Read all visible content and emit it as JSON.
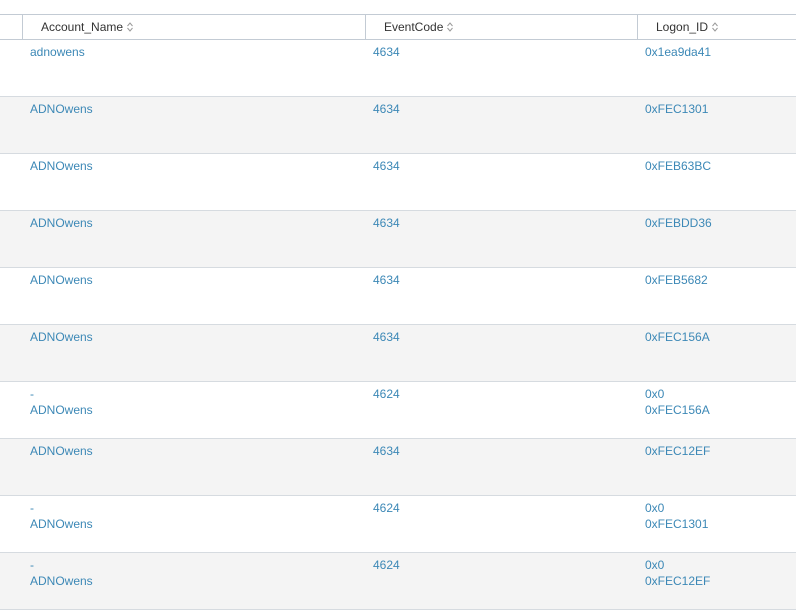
{
  "columns": [
    {
      "label": "Account_Name"
    },
    {
      "label": "EventCode"
    },
    {
      "label": "Logon_ID"
    }
  ],
  "rows": [
    {
      "account": [
        "adnowens"
      ],
      "event": "4634",
      "logon": [
        "0x1ea9da41"
      ]
    },
    {
      "account": [
        "ADNOwens"
      ],
      "event": "4634",
      "logon": [
        "0xFEC1301"
      ]
    },
    {
      "account": [
        "ADNOwens"
      ],
      "event": "4634",
      "logon": [
        "0xFEB63BC"
      ]
    },
    {
      "account": [
        "ADNOwens"
      ],
      "event": "4634",
      "logon": [
        "0xFEBDD36"
      ]
    },
    {
      "account": [
        "ADNOwens"
      ],
      "event": "4634",
      "logon": [
        "0xFEB5682"
      ]
    },
    {
      "account": [
        "ADNOwens"
      ],
      "event": "4634",
      "logon": [
        "0xFEC156A"
      ]
    },
    {
      "account": [
        "-",
        "ADNOwens"
      ],
      "event": "4624",
      "logon": [
        "0x0",
        "0xFEC156A"
      ]
    },
    {
      "account": [
        "ADNOwens"
      ],
      "event": "4634",
      "logon": [
        "0xFEC12EF"
      ]
    },
    {
      "account": [
        "-",
        "ADNOwens"
      ],
      "event": "4624",
      "logon": [
        "0x0",
        "0xFEC1301"
      ]
    },
    {
      "account": [
        "-",
        "ADNOwens"
      ],
      "event": "4624",
      "logon": [
        "0x0",
        "0xFEC12EF"
      ]
    }
  ]
}
